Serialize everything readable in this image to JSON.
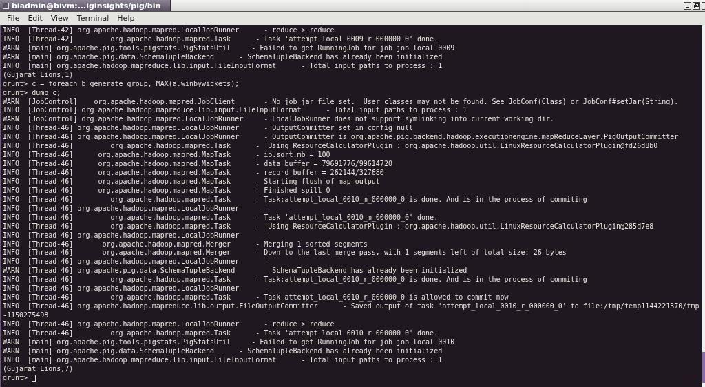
{
  "window": {
    "title": "biadmin@bivm:...iginsights/pig/bin"
  },
  "menu": [
    "File",
    "Edit",
    "View",
    "Terminal",
    "Help"
  ],
  "terminal": {
    "lines": [
      "INFO  [Thread-42] org.apache.hadoop.mapred.LocalJobRunner      - reduce > reduce",
      "INFO  [Thread-42]         org.apache.hadoop.mapred.Task      - Task 'attempt_local_0009_r_000000_0' done.",
      "WARN  [main] org.apache.pig.tools.pigstats.PigStatsUtil     - Failed to get RunningJob for job job_local_0009",
      "WARN  [main] org.apache.pig.data.SchemaTupleBackend      - SchemaTupleBackend has already been initialized",
      "INFO  [main] org.apache.hadoop.mapreduce.lib.input.FileInputFormat      - Total input paths to process : 1",
      "(Gujarat Lions,1)",
      "grunt> c = foreach b generate group, MAX(a.winbywickets);",
      "grunt> dump c;",
      "WARN  [JobControl]    org.apache.hadoop.mapred.JobClient       - No job jar file set.  User classes may not be found. See JobConf(Class) or JobConf#setJar(String).",
      "INFO  [JobControl] org.apache.hadoop.mapreduce.lib.input.FileInputFormat      - Total input paths to process : 1",
      "WARN  [JobControl] org.apache.hadoop.mapred.LocalJobRunner     - LocalJobRunner does not support symlinking into current working dir.",
      "INFO  [Thread-46] org.apache.hadoop.mapred.LocalJobRunner      - OutputCommitter set in config null",
      "INFO  [Thread-46] org.apache.hadoop.mapred.LocalJobRunner      - OutputCommitter is org.apache.pig.backend.hadoop.executionengine.mapReduceLayer.PigOutputCommitter",
      "INFO  [Thread-46]         org.apache.hadoop.mapred.Task      -  Using ResourceCalculatorPlugin : org.apache.hadoop.util.LinuxResourceCalculatorPlugin@fd26d8b0",
      "INFO  [Thread-46]      org.apache.hadoop.mapred.MapTask      - io.sort.mb = 100",
      "INFO  [Thread-46]      org.apache.hadoop.mapred.MapTask      - data buffer = 79691776/99614720",
      "INFO  [Thread-46]      org.apache.hadoop.mapred.MapTask      - record buffer = 262144/327680",
      "INFO  [Thread-46]      org.apache.hadoop.mapred.MapTask      - Starting flush of map output",
      "INFO  [Thread-46]      org.apache.hadoop.mapred.MapTask      - Finished spill 0",
      "INFO  [Thread-46]         org.apache.hadoop.mapred.Task      - Task:attempt_local_0010_m_000000_0 is done. And is in the process of commiting",
      "INFO  [Thread-46] org.apache.hadoop.mapred.LocalJobRunner      -",
      "INFO  [Thread-46]         org.apache.hadoop.mapred.Task      - Task 'attempt_local_0010_m_000000_0' done.",
      "INFO  [Thread-46]         org.apache.hadoop.mapred.Task      -  Using ResourceCalculatorPlugin : org.apache.hadoop.util.LinuxResourceCalculatorPlugin@285d7e8",
      "INFO  [Thread-46] org.apache.hadoop.mapred.LocalJobRunner      -",
      "INFO  [Thread-46]       org.apache.hadoop.mapred.Merger      - Merging 1 sorted segments",
      "INFO  [Thread-46]       org.apache.hadoop.mapred.Merger      - Down to the last merge-pass, with 1 segments left of total size: 26 bytes",
      "INFO  [Thread-46] org.apache.hadoop.mapred.LocalJobRunner      -",
      "WARN  [Thread-46] org.apache.pig.data.SchemaTupleBackend       - SchemaTupleBackend has already been initialized",
      "INFO  [Thread-46]         org.apache.hadoop.mapred.Task      - Task:attempt_local_0010_r_000000_0 is done. And is in the process of commiting",
      "INFO  [Thread-46] org.apache.hadoop.mapred.LocalJobRunner      -",
      "INFO  [Thread-46]         org.apache.hadoop.mapred.Task      - Task attempt_local_0010_r_000000_0 is allowed to commit now",
      "INFO  [Thread-46] org.apache.hadoop.mapreduce.lib.output.FileOutputCommitter      - Saved output of task 'attempt_local_0010_r_000000_0' to file:/tmp/temp1144221370/tmp",
      "-1150275498",
      "INFO  [Thread-46] org.apache.hadoop.mapred.LocalJobRunner      - reduce > reduce",
      "INFO  [Thread-46]         org.apache.hadoop.mapred.Task      - Task 'attempt_local_0010_r_000000_0' done.",
      "WARN  [main] org.apache.pig.tools.pigstats.PigStatsUtil     - Failed to get RunningJob for job job_local_0010",
      "WARN  [main] org.apache.pig.data.SchemaTupleBackend      - SchemaTupleBackend has already been initialized",
      "INFO  [main] org.apache.hadoop.mapreduce.lib.input.FileInputFormat      - Total input paths to process : 1",
      "(Gujarat Lions,7)"
    ],
    "prompt": "grunt>"
  }
}
